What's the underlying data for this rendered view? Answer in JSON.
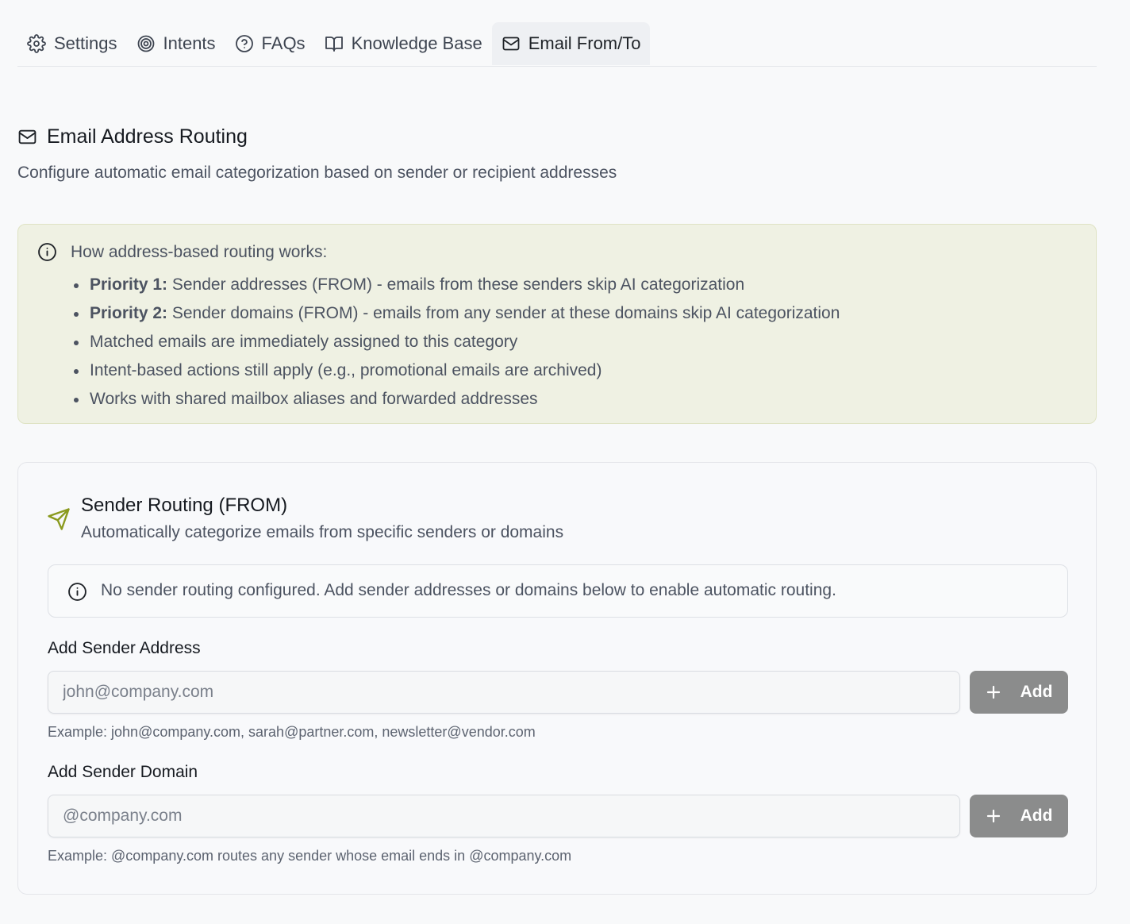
{
  "tabs": [
    {
      "label": "Settings",
      "icon": "gear-icon",
      "active": false
    },
    {
      "label": "Intents",
      "icon": "target-icon",
      "active": false
    },
    {
      "label": "FAQs",
      "icon": "help-circle-icon",
      "active": false
    },
    {
      "label": "Knowledge Base",
      "icon": "book-open-icon",
      "active": false
    },
    {
      "label": "Email From/To",
      "icon": "mail-icon",
      "active": true
    }
  ],
  "section": {
    "title": "Email Address Routing",
    "subtitle": "Configure automatic email categorization based on sender or recipient addresses"
  },
  "info": {
    "title": "How address-based routing works:",
    "items": [
      {
        "bold": "Priority 1:",
        "text": " Sender addresses (FROM) - emails from these senders skip AI categorization"
      },
      {
        "bold": "Priority 2:",
        "text": " Sender domains (FROM) - emails from any sender at these domains skip AI categorization"
      },
      {
        "bold": "",
        "text": "Matched emails are immediately assigned to this category"
      },
      {
        "bold": "",
        "text": "Intent-based actions still apply (e.g., promotional emails are archived)"
      },
      {
        "bold": "",
        "text": "Works with shared mailbox aliases and forwarded addresses"
      }
    ]
  },
  "sender_routing": {
    "title": "Sender Routing (FROM)",
    "description": "Automatically categorize emails from specific senders or domains",
    "notice": "No sender routing configured. Add sender addresses or domains below to enable automatic routing.",
    "address": {
      "label": "Add Sender Address",
      "value": "",
      "placeholder": "john@company.com",
      "button": "Add",
      "hint": "Example: john@company.com, sarah@partner.com, newsletter@vendor.com"
    },
    "domain": {
      "label": "Add Sender Domain",
      "value": "",
      "placeholder": "@company.com",
      "button": "Add",
      "hint": "Example: @company.com routes any sender whose email ends in @company.com"
    }
  },
  "colors": {
    "accent_icon": "#8a9a1e",
    "info_background": "#eff1e3",
    "add_button": "#8b8c8c"
  }
}
